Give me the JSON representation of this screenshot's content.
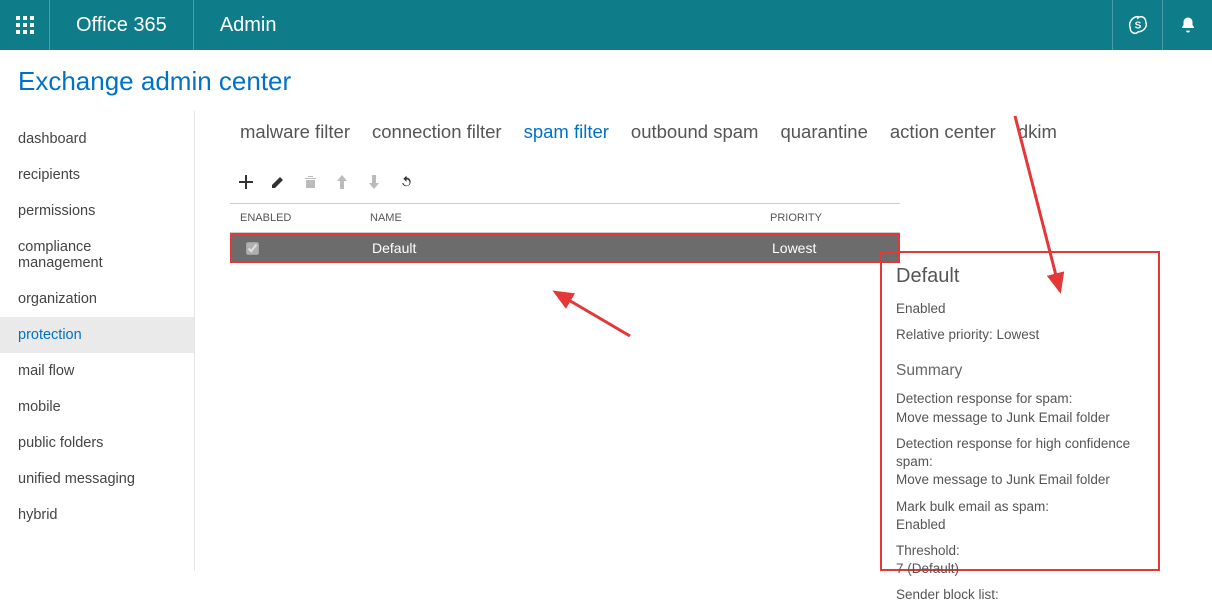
{
  "topbar": {
    "brand": "Office 365",
    "appname": "Admin"
  },
  "page_title": "Exchange admin center",
  "leftnav": [
    "dashboard",
    "recipients",
    "permissions",
    "compliance management",
    "organization",
    "protection",
    "mail flow",
    "mobile",
    "public folders",
    "unified messaging",
    "hybrid"
  ],
  "leftnav_active": "protection",
  "tabs": [
    "malware filter",
    "connection filter",
    "spam filter",
    "outbound spam",
    "quarantine",
    "action center",
    "dkim"
  ],
  "active_tab": "spam filter",
  "columns": {
    "c1": "ENABLED",
    "c2": "NAME",
    "c3": "PRIORITY"
  },
  "rows": [
    {
      "enabled": true,
      "name": "Default",
      "priority": "Lowest"
    }
  ],
  "details": {
    "title": "Default",
    "status": "Enabled",
    "priority_label": "Relative priority: Lowest",
    "summary_label": "Summary",
    "lines": [
      {
        "k": "Detection response for spam:",
        "v": "Move message to Junk Email folder"
      },
      {
        "k": "Detection response for high confidence spam:",
        "v": "Move message to Junk Email folder"
      },
      {
        "k": "Mark bulk email as spam:",
        "v": "Enabled"
      },
      {
        "k": "Threshold:",
        "v": "7 (Default)"
      },
      {
        "k": "Sender block list:",
        "v": ""
      }
    ]
  }
}
